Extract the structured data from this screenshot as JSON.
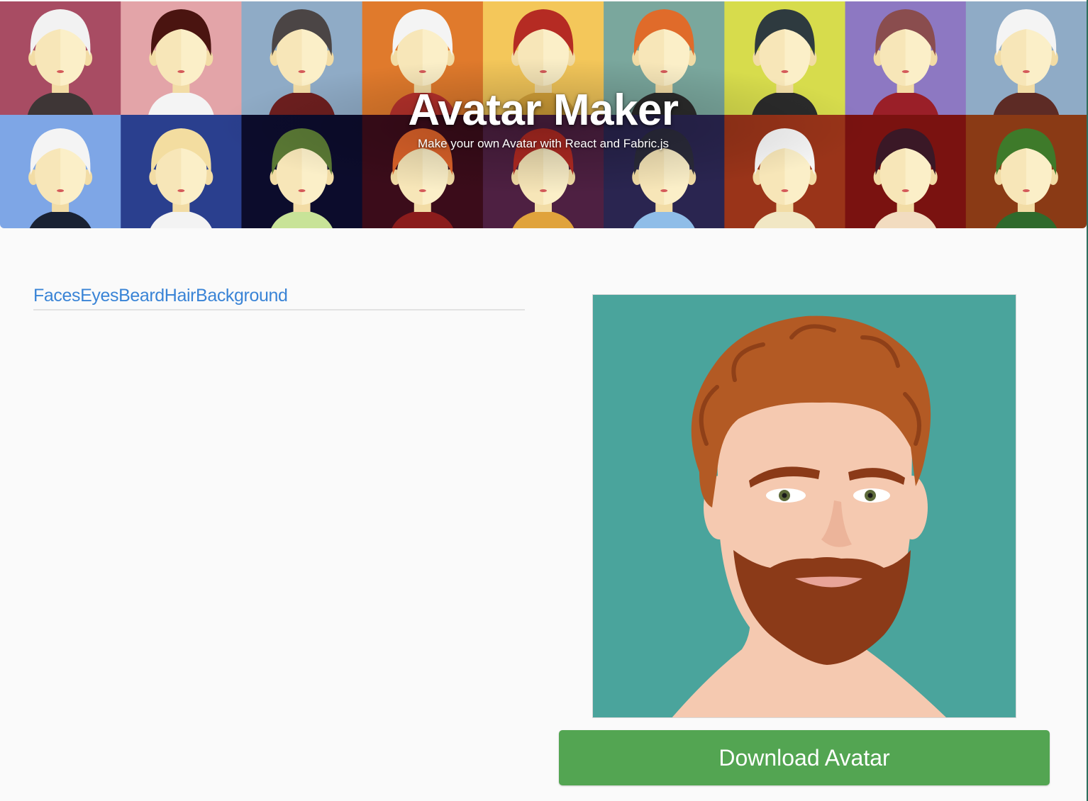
{
  "hero": {
    "title": "Avatar Maker",
    "subtitle": "Make your own Avatar with React and Fabric.js",
    "tiles": [
      {
        "bg": "#a84c63",
        "hair": "#f2f2f2",
        "shirt": "#3e3636"
      },
      {
        "bg": "#e3a4a8",
        "hair": "#4a1410",
        "shirt": "#f4f4f4"
      },
      {
        "bg": "#8fabc6",
        "hair": "#4b4545",
        "shirt": "#6e1f1f"
      },
      {
        "bg": "#e07a2c",
        "hair": "#f4f4f4",
        "shirt": "#b8322c"
      },
      {
        "bg": "#f4c75a",
        "hair": "#b52b23",
        "shirt": "#d9a53a"
      },
      {
        "bg": "#7aa79d",
        "hair": "#e06b2a",
        "shirt": "#2c2c2c"
      },
      {
        "bg": "#d7dc4c",
        "hair": "#2e3a3f",
        "shirt": "#2b2b2b"
      },
      {
        "bg": "#8d78c2",
        "hair": "#8a4d4e",
        "shirt": "#9a1f28"
      },
      {
        "bg": "#8fabc6",
        "hair": "#f4f4f4",
        "shirt": "#5d2b25"
      },
      {
        "bg": "#7ea6e6",
        "hair": "#f4f4f4",
        "shirt": "#1a2233"
      },
      {
        "bg": "#2a3f8e",
        "hair": "#f3dda0",
        "shirt": "#f3f3f3"
      },
      {
        "bg": "#0c0c2c",
        "hair": "#5b7a35",
        "shirt": "#c8e398"
      },
      {
        "bg": "#3b0c1a",
        "hair": "#e0642a",
        "shirt": "#8b1c1c"
      },
      {
        "bg": "#4e2042",
        "hair": "#b52b23",
        "shirt": "#e0a33c"
      },
      {
        "bg": "#2a2550",
        "hair": "#2b2b3b",
        "shirt": "#8fbde8"
      },
      {
        "bg": "#9a3419",
        "hair": "#f6f6f6",
        "shirt": "#f1e7c4"
      },
      {
        "bg": "#7a1210",
        "hair": "#3a1826",
        "shirt": "#f2dcc0"
      },
      {
        "bg": "#8a3a15",
        "hair": "#3e7a2a",
        "shirt": "#2f6a2c"
      }
    ]
  },
  "tabs": [
    {
      "label": "Faces"
    },
    {
      "label": "Eyes"
    },
    {
      "label": "Beard"
    },
    {
      "label": "Hair"
    },
    {
      "label": "Background"
    }
  ],
  "preview": {
    "background": "#4aa49c",
    "skin": "#f5c9b0",
    "hair": "#b35a24",
    "beard": "#8b3a18",
    "eyes": "#5d6a3a"
  },
  "download_label": "Download Avatar",
  "colors": {
    "link": "#3a84d6",
    "button": "#53a552"
  }
}
